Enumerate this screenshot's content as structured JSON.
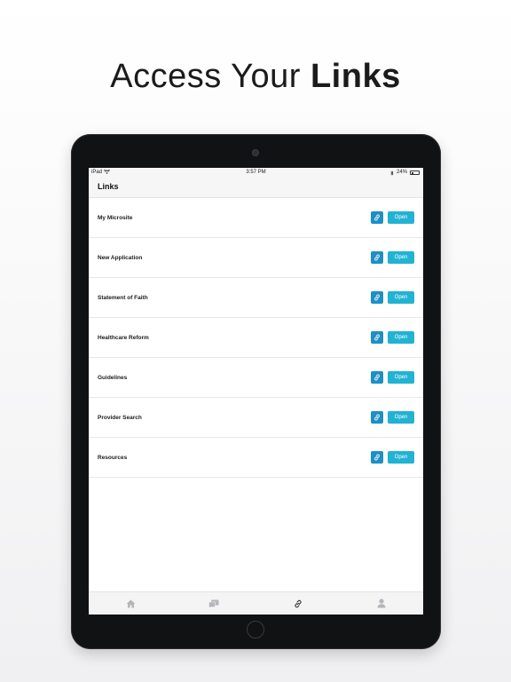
{
  "headline": {
    "regular": "Access Your",
    "bold": "Links"
  },
  "status_bar": {
    "carrier": "iPad",
    "time": "3:57 PM",
    "battery": "24%",
    "battery_level": 0.24
  },
  "nav": {
    "title": "Links"
  },
  "rows": [
    {
      "label": "My Microsite",
      "open_label": "Open"
    },
    {
      "label": "New Application",
      "open_label": "Open"
    },
    {
      "label": "Statement of Faith",
      "open_label": "Open"
    },
    {
      "label": "Healthcare Reform",
      "open_label": "Open"
    },
    {
      "label": "Guidelines",
      "open_label": "Open"
    },
    {
      "label": "Provider Search",
      "open_label": "Open"
    },
    {
      "label": "Resources",
      "open_label": "Open"
    }
  ],
  "tabs": [
    {
      "name": "home",
      "icon": "home-icon",
      "active": false
    },
    {
      "name": "messages",
      "icon": "chat-icon",
      "active": false
    },
    {
      "name": "links",
      "icon": "link-icon",
      "active": true
    },
    {
      "name": "profile",
      "icon": "person-icon",
      "active": false
    }
  ],
  "colors": {
    "link_button": "#1e8fc4",
    "open_button": "#21b2d4",
    "tab_inactive": "#b5b5ba",
    "tab_active": "#222222"
  }
}
